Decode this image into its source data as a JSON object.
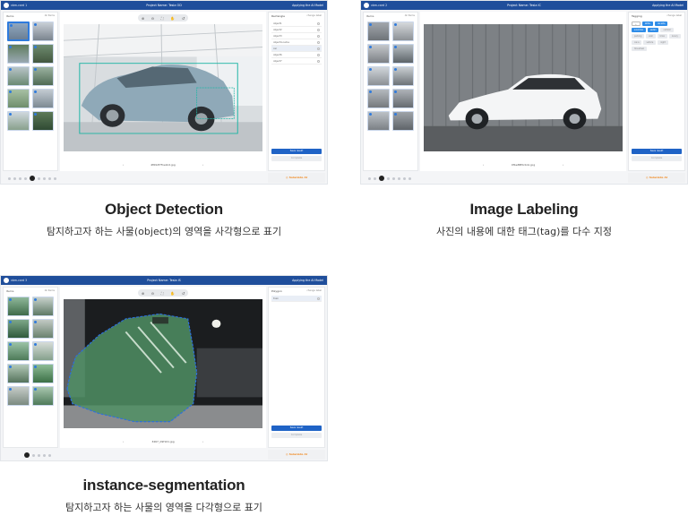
{
  "cards": [
    {
      "brand": "vbm-card 1",
      "project": "Project Name: Tesla OD",
      "right": "Applying the AI Model",
      "left_header": "Items",
      "left_filter": "All Items",
      "panel_title": "Rectangle",
      "panel_right": "change label",
      "labels": [
        "object1",
        "object2",
        "object3",
        "object4-name",
        "car",
        "object6",
        "object7"
      ],
      "selected_label": 4,
      "save_label": "Save result",
      "alt_label": "Complete",
      "file_name": "4f69df7f1e9cd.jpg",
      "footer": "◎ Solarside AI",
      "title": "Object Detection",
      "subtitle": "탐지하고자 하는 사물(object)의 영역을 사각형으로 표기"
    },
    {
      "brand": "vbm-card 2",
      "project": "Project Name: Tesla IC",
      "right": "Applying the AI Model",
      "left_header": "Items",
      "left_filter": "All Items",
      "panel_title": "Tagging",
      "panel_right": "change label",
      "tags": [
        {
          "text": "+",
          "on": false
        },
        {
          "text": "white",
          "on": true
        },
        {
          "text": "car-side",
          "on": true
        },
        {
          "text": "suv-bmw",
          "on": true
        },
        {
          "text": "sedan",
          "on": true
        },
        {
          "text": "outdoor",
          "on": false
        },
        {
          "text": "parking",
          "on": false
        },
        {
          "text": "wall",
          "on": false
        },
        {
          "text": "bmw",
          "on": false
        },
        {
          "text": "luxury",
          "on": false
        },
        {
          "text": "car-a",
          "on": false
        },
        {
          "text": "vehicle",
          "on": false
        },
        {
          "text": "night",
          "on": false
        },
        {
          "text": "tire-wheel",
          "on": false
        }
      ],
      "save_label": "Save result",
      "alt_label": "Complete",
      "file_name": "0fbe88f0cb4c.jpg",
      "footer": "◎ Solarside AI",
      "title": "Image Labeling",
      "subtitle": "사진의 내용에 대한 태그(tag)를 다수 지정"
    },
    {
      "brand": "vbm-card 3",
      "project": "Project Name: Tesla IS",
      "right": "Applying the AI Model",
      "left_header": "Items",
      "left_filter": "All Items",
      "panel_title": "Polygon",
      "panel_right": "change label",
      "labels": [
        "train"
      ],
      "selected_label": 0,
      "save_label": "Save result",
      "alt_label": "Complete",
      "file_name": "3467_09f101.jpg",
      "footer": "◎ Solarside AI",
      "title": "instance-segmentation",
      "subtitle": "탐지하고자 하는 사물의 영역을 다각형으로 표기"
    }
  ],
  "colors": {
    "header": "#1f4e9b",
    "accent": "#2f7bdd",
    "orange": "#f08a22"
  },
  "icons": [
    "logo-icon",
    "zoom-in-icon",
    "zoom-out-icon",
    "fit-icon",
    "hand-icon",
    "undo-icon",
    "prev-icon",
    "next-icon"
  ],
  "toolbar_glyphs": [
    "⊕",
    "⊖",
    "⛶",
    "✋",
    "↺"
  ],
  "nav": {
    "prev": "‹",
    "next": "›"
  }
}
